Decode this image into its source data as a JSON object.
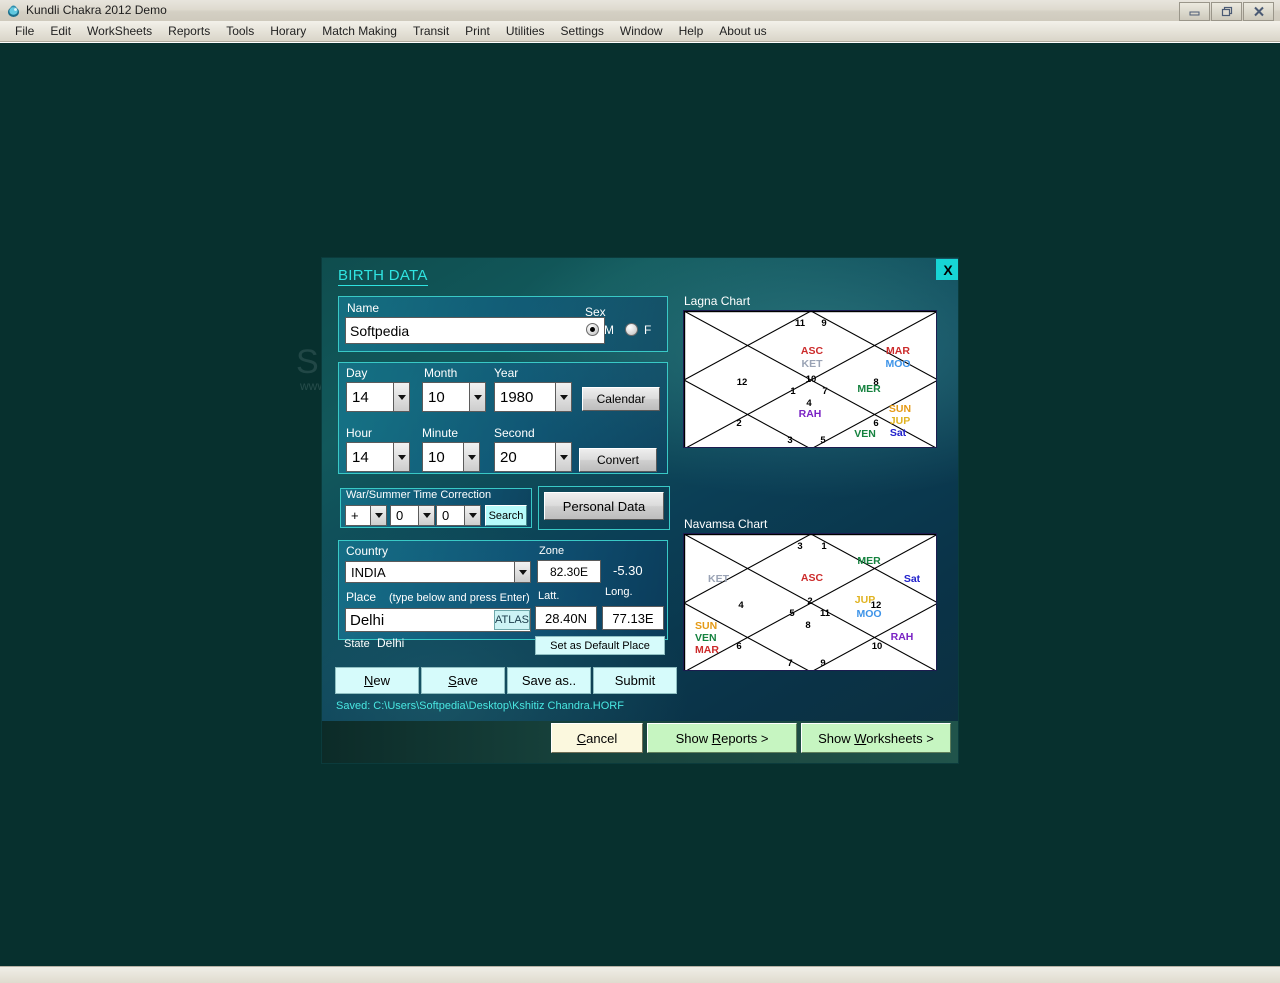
{
  "window": {
    "title": "Kundli Chakra 2012 Demo",
    "icon": "app-icon",
    "controls": {
      "minimize": "minimize-icon",
      "restore": "restore-icon",
      "close": "close-icon"
    }
  },
  "menubar": {
    "items": [
      "File",
      "Edit",
      "WorkSheets",
      "Reports",
      "Tools",
      "Horary",
      "Match Making",
      "Transit",
      "Print",
      "Utilities",
      "Settings",
      "Window",
      "Help",
      "About us"
    ]
  },
  "watermark": {
    "line1": "SOFTPEDIA",
    "line2": "www.softpedia.com"
  },
  "dialog": {
    "title": "BIRTH DATA",
    "close_label": "X",
    "name": {
      "label": "Name",
      "value": "Softpedia"
    },
    "sex": {
      "label": "Sex",
      "options": [
        {
          "label": "M",
          "selected": true
        },
        {
          "label": "F",
          "selected": false
        }
      ]
    },
    "date": {
      "day": {
        "label": "Day",
        "value": "14"
      },
      "month": {
        "label": "Month",
        "value": "10"
      },
      "year": {
        "label": "Year",
        "value": "1980"
      },
      "calendar_button": "Calendar"
    },
    "time": {
      "hour": {
        "label": "Hour",
        "value": "14"
      },
      "minute": {
        "label": "Minute",
        "value": "10"
      },
      "second": {
        "label": "Second",
        "value": "20"
      },
      "convert_button": "Convert"
    },
    "war_time": {
      "legend": "War/Summer Time Correction",
      "sign": "+",
      "hours": "0",
      "minutes": "0",
      "search_button": "Search"
    },
    "personal_data_button": "Personal Data",
    "location": {
      "country_label": "Country",
      "country_value": "INDIA",
      "zone_label": "Zone",
      "zone_value": "82.30E",
      "zone_offset": "-5.30",
      "place_label": "Place",
      "place_hint": "(type below and press Enter)",
      "place_value": "Delhi",
      "atlas_button": "ATLAS",
      "latt_label": "Latt.",
      "latt_value": "28.40N",
      "long_label": "Long.",
      "long_value": "77.13E",
      "state_label": "State",
      "state_value": "Delhi",
      "default_place_button": "Set as Default Place"
    },
    "record_buttons": [
      {
        "pre": "",
        "accel": "N",
        "post": "ew"
      },
      {
        "pre": "",
        "accel": "S",
        "post": "ave"
      },
      {
        "pre": "Save as..",
        "accel": "",
        "post": ""
      },
      {
        "pre": "Submit",
        "accel": "",
        "post": ""
      }
    ],
    "saved_text": "Saved: C:\\Users\\Softpedia\\Desktop\\Kshitiz Chandra.HORF",
    "footer_buttons": [
      {
        "pre": "",
        "accel": "C",
        "post": "ancel",
        "style": "cream"
      },
      {
        "pre": "Show ",
        "accel": "R",
        "post": "eports >",
        "style": "green"
      },
      {
        "pre": "Show ",
        "accel": "W",
        "post": "orksheets >",
        "style": "green"
      }
    ]
  },
  "colors": {
    "asc": "#cc2b2b",
    "ket": "#9aa3b5",
    "mar": "#cc2b2b",
    "moo": "#3d93e8",
    "mer": "#15823f",
    "ven": "#15823f",
    "rah": "#7a23c4",
    "sun": "#e59a15",
    "jup": "#e0b321",
    "sat": "#2222cc",
    "house_number": "#000000",
    "accent_cyan": "#2fe3e0"
  },
  "chart_data": [
    {
      "type": "north-indian-kundli",
      "title": "Lagna Chart",
      "houses": [
        {
          "number": "1",
          "pos": "left-inner",
          "planets": []
        },
        {
          "number": "2",
          "pos": "left-lower",
          "planets": []
        },
        {
          "number": "3",
          "pos": "bottom-left",
          "planets": []
        },
        {
          "number": "4",
          "pos": "bottom-inner",
          "planets": [
            "RAH"
          ]
        },
        {
          "number": "5",
          "pos": "bottom-right",
          "planets": [
            "VEN"
          ]
        },
        {
          "number": "6",
          "pos": "right-lower",
          "planets": [
            "SUN",
            "JUP",
            "Sat"
          ]
        },
        {
          "number": "7",
          "pos": "right-inner",
          "planets": [
            "MER"
          ]
        },
        {
          "number": "8",
          "pos": "right-upper",
          "planets": [
            "MAR",
            "MOO"
          ]
        },
        {
          "number": "9",
          "pos": "top-right",
          "planets": []
        },
        {
          "number": "10",
          "pos": "top-inner",
          "planets": [
            "ASC",
            "KET"
          ]
        },
        {
          "number": "11",
          "pos": "top-left",
          "planets": []
        },
        {
          "number": "12",
          "pos": "left-upper",
          "planets": []
        }
      ],
      "planet_placements": [
        {
          "planet": "ASC",
          "house": "10",
          "color": "#cc2b2b"
        },
        {
          "planet": "KET",
          "house": "10",
          "color": "#9aa3b5"
        },
        {
          "planet": "MAR",
          "house": "8",
          "color": "#cc2b2b"
        },
        {
          "planet": "MOO",
          "house": "8",
          "color": "#3d93e8"
        },
        {
          "planet": "MER",
          "house": "7",
          "color": "#15823f"
        },
        {
          "planet": "SUN",
          "house": "6",
          "color": "#e59a15"
        },
        {
          "planet": "JUP",
          "house": "6",
          "color": "#e0b321"
        },
        {
          "planet": "Sat",
          "house": "6",
          "color": "#2222cc"
        },
        {
          "planet": "VEN",
          "house": "5",
          "color": "#15823f"
        },
        {
          "planet": "RAH",
          "house": "4",
          "color": "#7a23c4"
        }
      ]
    },
    {
      "type": "north-indian-kundli",
      "title": "Navamsa Chart",
      "houses": [
        {
          "number": "1",
          "pos": "top-right",
          "planets": [
            "MER"
          ]
        },
        {
          "number": "2",
          "pos": "top-inner",
          "planets": [
            "ASC"
          ]
        },
        {
          "number": "3",
          "pos": "top-left",
          "planets": []
        },
        {
          "number": "4",
          "pos": "left-upper",
          "planets": [
            "KET"
          ]
        },
        {
          "number": "5",
          "pos": "left-inner",
          "planets": []
        },
        {
          "number": "6",
          "pos": "left-lower",
          "planets": [
            "SUN",
            "VEN",
            "MAR"
          ]
        },
        {
          "number": "7",
          "pos": "bottom-left",
          "planets": []
        },
        {
          "number": "8",
          "pos": "bottom-inner",
          "planets": []
        },
        {
          "number": "9",
          "pos": "bottom-right",
          "planets": []
        },
        {
          "number": "10",
          "pos": "right-lower",
          "planets": [
            "RAH"
          ]
        },
        {
          "number": "11",
          "pos": "right-inner",
          "planets": [
            "JUP",
            "MOO"
          ]
        },
        {
          "number": "12",
          "pos": "right-upper",
          "planets": [
            "Sat"
          ]
        }
      ],
      "planet_placements": [
        {
          "planet": "MER",
          "house": "1",
          "color": "#15823f"
        },
        {
          "planet": "ASC",
          "house": "2",
          "color": "#cc2b2b"
        },
        {
          "planet": "KET",
          "house": "4",
          "color": "#9aa3b5"
        },
        {
          "planet": "SUN",
          "house": "6",
          "color": "#e59a15"
        },
        {
          "planet": "VEN",
          "house": "6",
          "color": "#15823f"
        },
        {
          "planet": "MAR",
          "house": "6",
          "color": "#cc2b2b"
        },
        {
          "planet": "RAH",
          "house": "10",
          "color": "#7a23c4"
        },
        {
          "planet": "JUP",
          "house": "11",
          "color": "#e0b321"
        },
        {
          "planet": "MOO",
          "house": "11",
          "color": "#3d93e8"
        },
        {
          "planet": "Sat",
          "house": "12",
          "color": "#2222cc"
        }
      ]
    }
  ]
}
